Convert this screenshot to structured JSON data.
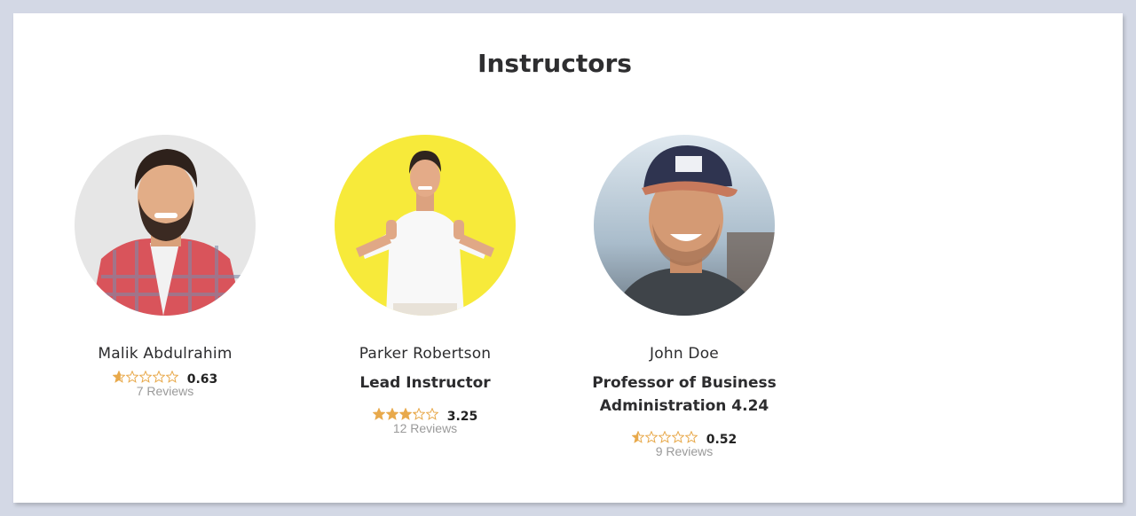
{
  "section": {
    "title": "Instructors"
  },
  "colors": {
    "star": "#e8a94b",
    "background": "#d3d8e5",
    "card": "#ffffff"
  },
  "instructors": [
    {
      "name": "Malik Abdulrahim",
      "role": "",
      "rating": 0.63,
      "rating_text": "0.63",
      "reviews": "7 Reviews",
      "avatar_bg": "#e6e6e6"
    },
    {
      "name": "Parker Robertson",
      "role": "Lead Instructor",
      "rating": 3.25,
      "rating_text": "3.25",
      "reviews": "12 Reviews",
      "avatar_bg": "#f7ea3a"
    },
    {
      "name": "John Doe",
      "role": "Professor of Business Administration 4.24",
      "rating": 0.52,
      "rating_text": "0.52",
      "reviews": "9 Reviews",
      "avatar_bg": "#b8c9d6"
    }
  ]
}
